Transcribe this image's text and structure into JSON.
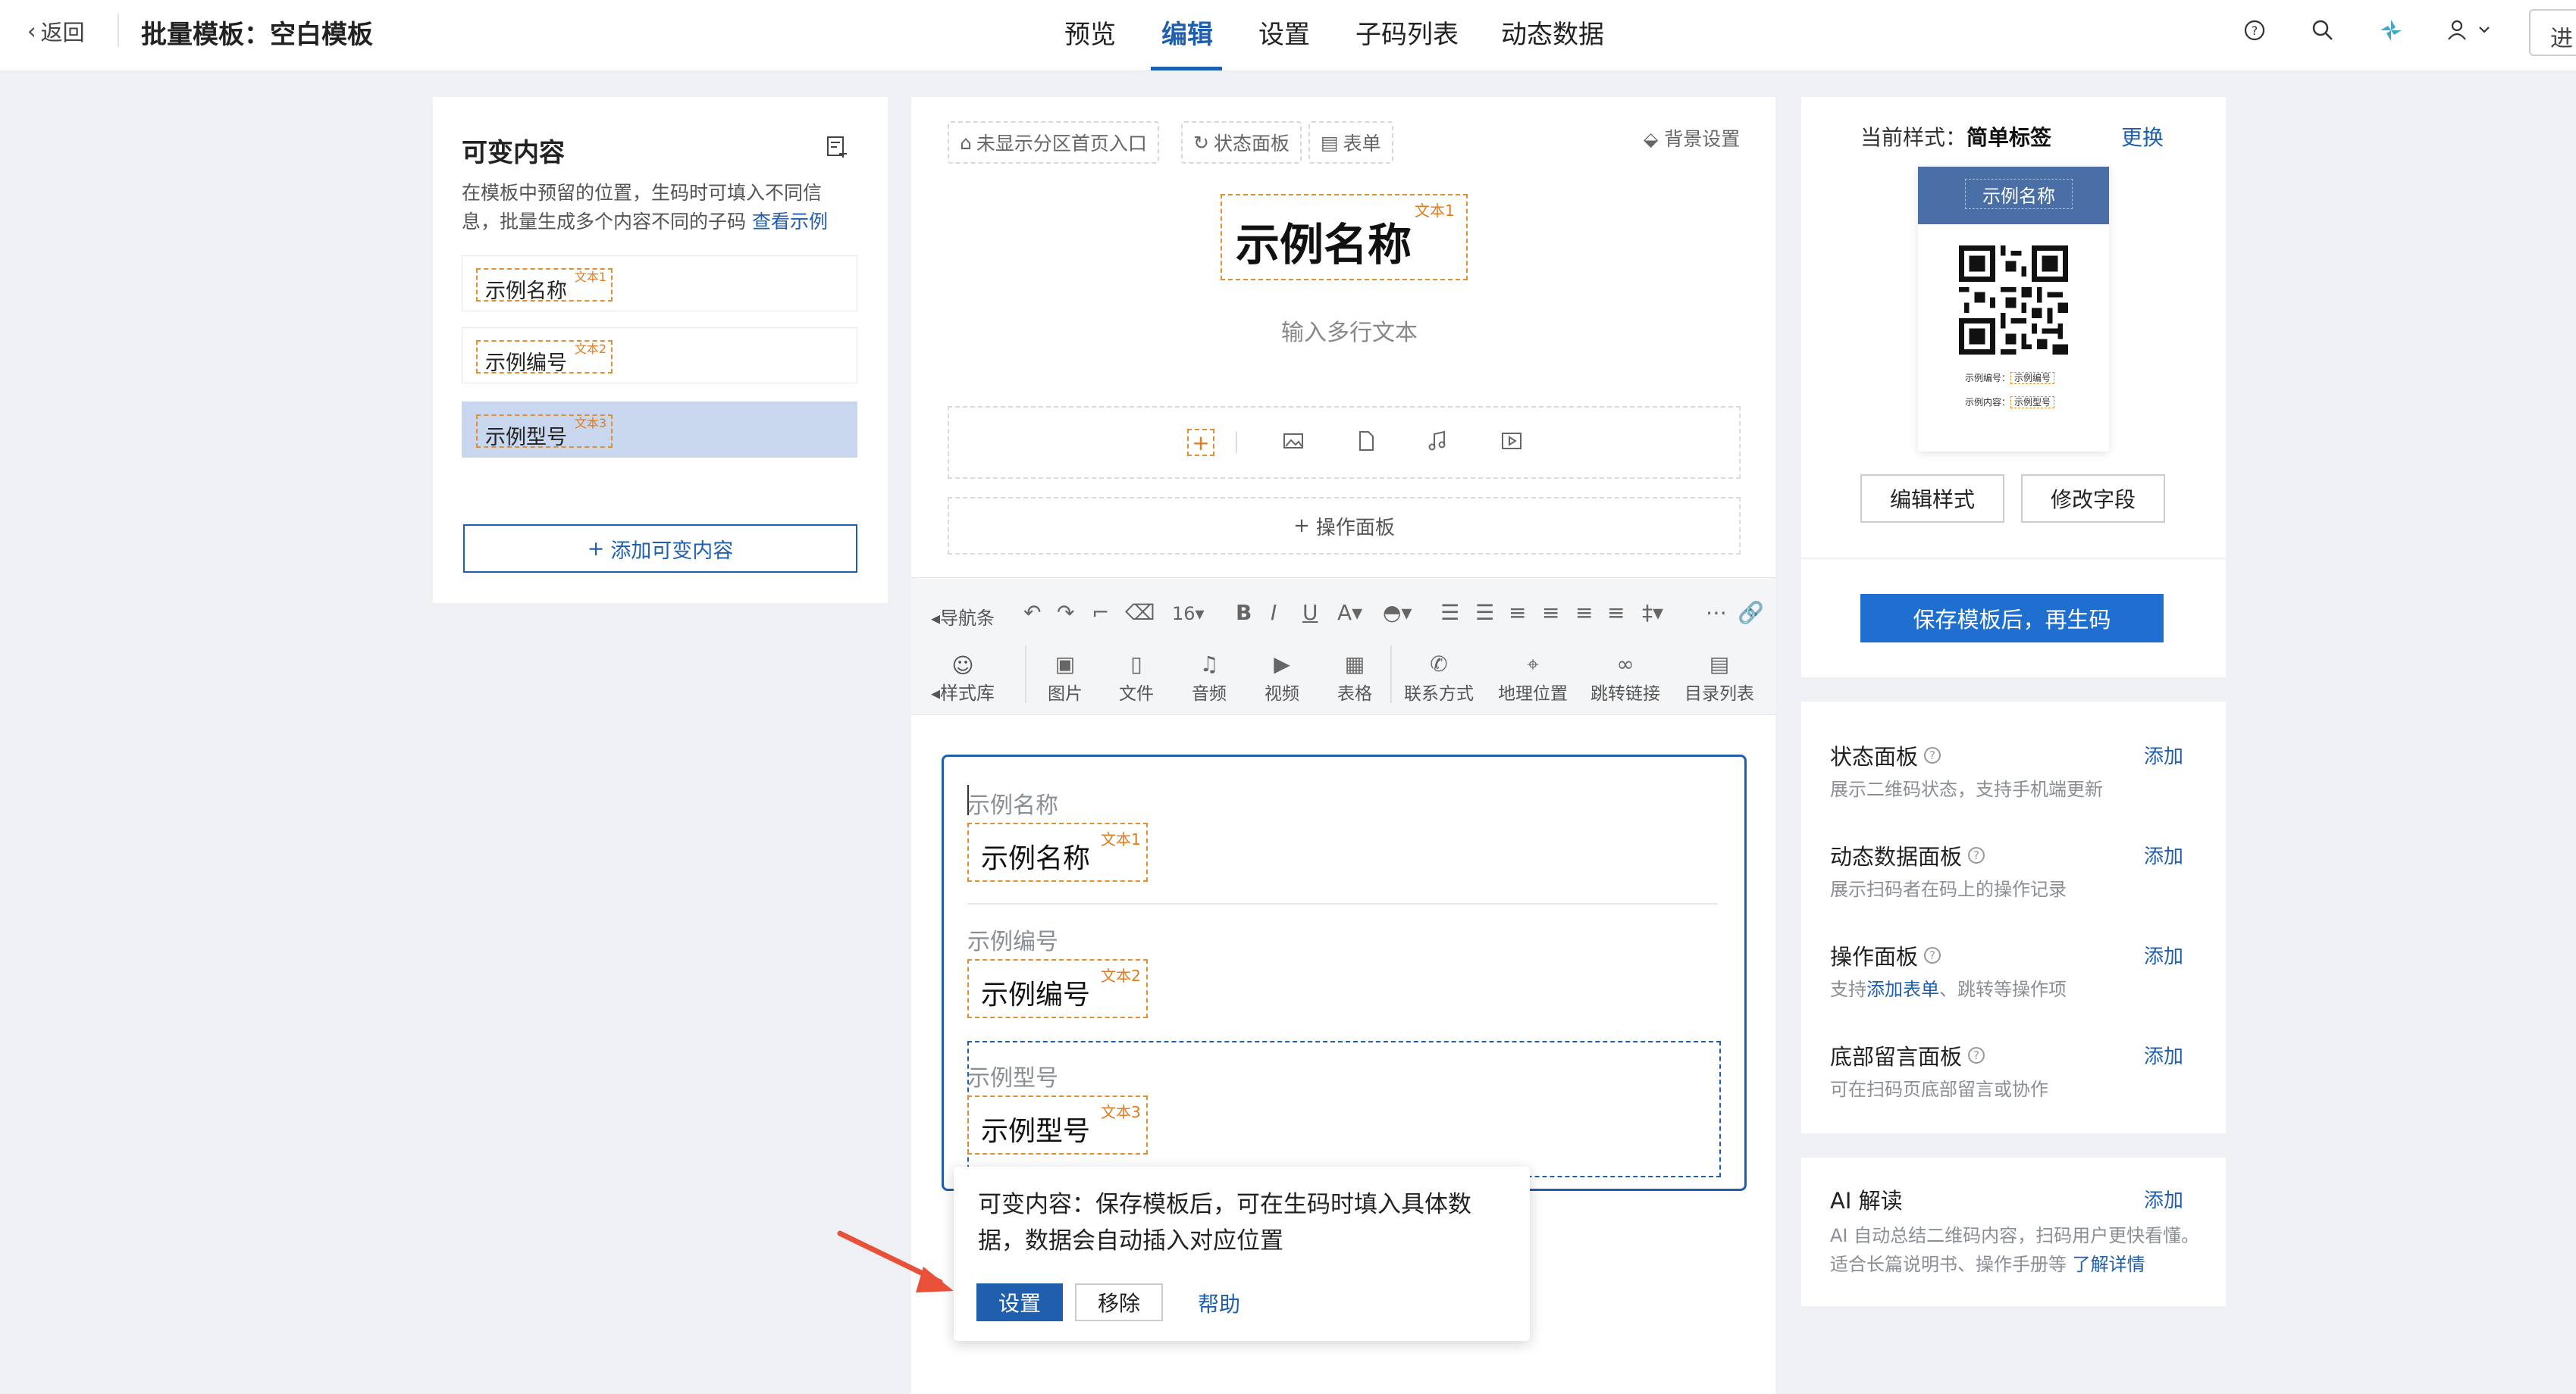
{
  "header": {
    "back": "返回",
    "title": "批量模板：空白模板",
    "tabs": [
      "预览",
      "编辑",
      "设置",
      "子码列表",
      "动态数据"
    ],
    "enter": "进"
  },
  "left": {
    "title": "可变内容",
    "desc": "在模板中预留的位置，生码时可填入不同信息，批量生成多个内容不同的子码",
    "example_link": "查看示例",
    "items": [
      {
        "label": "示例名称",
        "tag": "文本1"
      },
      {
        "label": "示例编号",
        "tag": "文本2"
      },
      {
        "label": "示例型号",
        "tag": "文本3"
      }
    ],
    "add_button": "添加可变内容"
  },
  "canvas": {
    "pills": [
      "未显示分区首页入口",
      "状态面板",
      "表单"
    ],
    "bg_setting": "背景设置",
    "big_name": "示例名称",
    "big_tag": "文本1",
    "multiline_placeholder": "输入多行文本",
    "op_panel": "操作面板"
  },
  "toolbar": {
    "nav": "导航条",
    "font_size": "16",
    "style_lib": "样式库",
    "buttons": [
      "图片",
      "文件",
      "音频",
      "视频",
      "表格",
      "联系方式",
      "地理位置",
      "跳转链接",
      "目录列表"
    ]
  },
  "editor": {
    "fields": [
      {
        "label": "示例名称",
        "value": "示例名称",
        "tag": "文本1"
      },
      {
        "label": "示例编号",
        "value": "示例编号",
        "tag": "文本2"
      },
      {
        "label": "示例型号",
        "value": "示例型号",
        "tag": "文本3"
      }
    ]
  },
  "popover": {
    "text": "可变内容：保存模板后，可在生码时填入具体数据，数据会自动插入对应位置",
    "set": "设置",
    "remove": "移除",
    "help": "帮助"
  },
  "style_card": {
    "current_label": "当前样式：",
    "current_value": "简单标签",
    "change": "更换",
    "card_title": "示例名称",
    "line1_label": "示例编号：",
    "line1_value": "示例编号",
    "line2_label": "示例内容：",
    "line2_value": "示例型号",
    "edit_style": "编辑样式",
    "edit_fields": "修改字段",
    "save": "保存模板后，再生码"
  },
  "modules": [
    {
      "title": "状态面板",
      "desc": "展示二维码状态，支持手机端更新",
      "add": "添加"
    },
    {
      "title": "动态数据面板",
      "desc": "展示扫码者在码上的操作记录",
      "add": "添加"
    },
    {
      "title": "操作面板",
      "desc_pre": "支持",
      "desc_link": "添加表单",
      "desc_post": "、跳转等操作项",
      "add": "添加"
    },
    {
      "title": "底部留言面板",
      "desc": "可在扫码页底部留言或协作",
      "add": "添加"
    }
  ],
  "ai": {
    "title": "AI 解读",
    "add": "添加",
    "desc": "AI 自动总结二维码内容，扫码用户更快看懂。适合长篇说明书、操作手册等",
    "link": "了解详情"
  },
  "colors": {
    "primary": "#1f5fae",
    "accent_orange": "#e09030",
    "card_header": "#4a6fa7"
  }
}
